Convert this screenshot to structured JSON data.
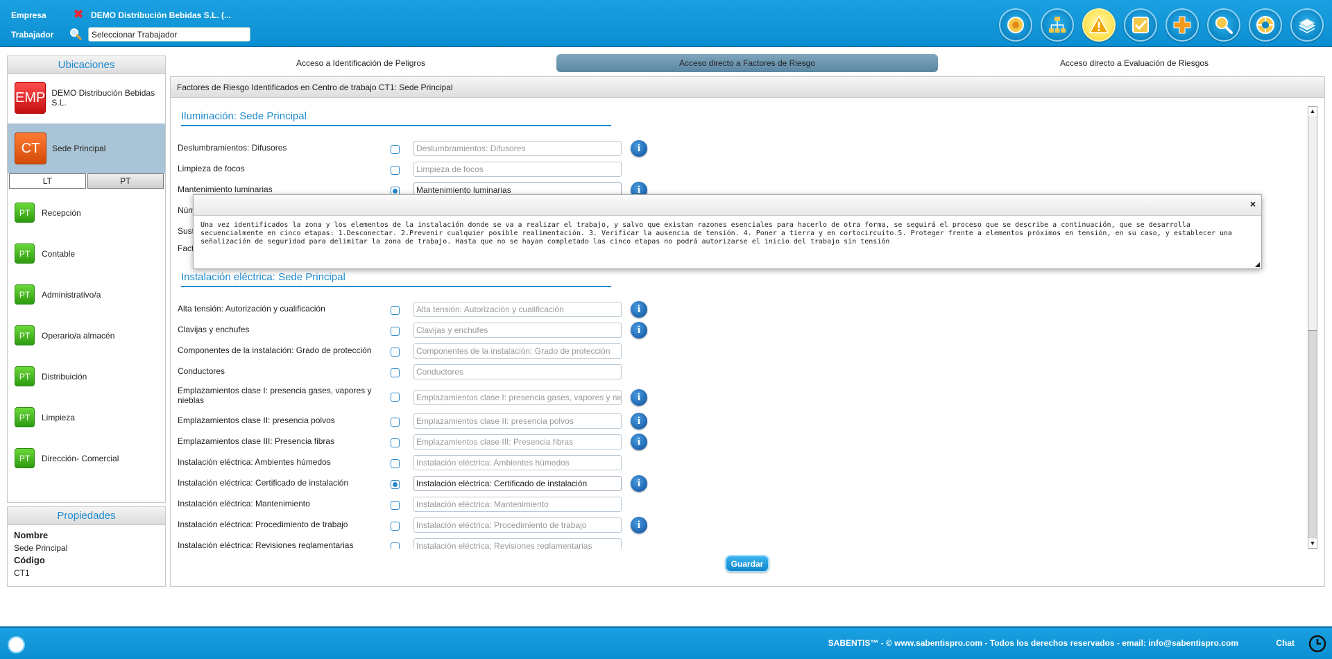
{
  "header": {
    "empresa_label": "Empresa",
    "empresa_value": "DEMO Distribución Bebidas S.L. (...",
    "trabajador_label": "Trabajador",
    "trabajador_value": "Seleccionar Trabajador",
    "icons": [
      "dashboard-icon",
      "org-chart-icon",
      "warning-icon",
      "checklist-icon",
      "add-icon",
      "search-icon",
      "help-icon",
      "documents-icon"
    ],
    "active_icon": "warning-icon"
  },
  "sidebar": {
    "title": "Ubicaciones",
    "empresa": {
      "badge": "EMP",
      "name": "DEMO Distribución Bebidas S.L."
    },
    "centro": {
      "badge": "CT",
      "name": "Sede Principal"
    },
    "tabs": [
      "LT",
      "PT"
    ],
    "active_tab": "PT",
    "puestos": [
      {
        "badge": "PT",
        "name": "Recepción"
      },
      {
        "badge": "PT",
        "name": "Contable"
      },
      {
        "badge": "PT",
        "name": "Administrativo/a"
      },
      {
        "badge": "PT",
        "name": "Operario/a almacén"
      },
      {
        "badge": "PT",
        "name": "Distribuición"
      },
      {
        "badge": "PT",
        "name": "Limpieza"
      },
      {
        "badge": "PT",
        "name": "Dirección- Comercial"
      }
    ]
  },
  "properties": {
    "title": "Propiedades",
    "name_key": "Nombre",
    "name_value": "Sede Principal",
    "code_key": "Código",
    "code_value": "CT1"
  },
  "nav_tabs": [
    "Acceso a Identificación de Peligros",
    "Acceso directo a Factores de Riesgo",
    "Acceso directo a Evaluación de Riesgos"
  ],
  "active_nav_tab": 1,
  "main": {
    "heading": "Factores de Riesgo Identificados en  Centro de trabajo CT1: Sede Principal",
    "sections": [
      {
        "title": "Iluminación: Sede Principal",
        "rows": [
          {
            "label": "Deslumbramientos: Difusores",
            "checked": false,
            "value": "Deslumbramientos: Difusores",
            "info": true
          },
          {
            "label": "Limpieza de focos",
            "checked": false,
            "value": "Limpieza de focos",
            "info": false
          },
          {
            "label": "Mantenimiento luminarias",
            "checked": true,
            "value": "Mantenimiento luminarias",
            "info": true
          },
          {
            "label": "Núm",
            "checked": false,
            "value": "",
            "info": false
          },
          {
            "label": "Sust",
            "checked": false,
            "value": "",
            "info": false
          },
          {
            "label": "Fact",
            "checked": false,
            "value": "",
            "info": false
          }
        ]
      },
      {
        "title": "Instalación eléctrica: Sede Principal",
        "rows": [
          {
            "label": "Alta tensión: Autorización y cualificación",
            "checked": false,
            "value": "Alta tensión: Autorización y cualificación",
            "info": true
          },
          {
            "label": "Clavijas y enchufes",
            "checked": false,
            "value": "Clavijas y enchufes",
            "info": true
          },
          {
            "label": "Componentes de la instalación: Grado de protección",
            "checked": false,
            "value": "Componentes de la instalación: Grado de protección",
            "info": false
          },
          {
            "label": "Conductores",
            "checked": false,
            "value": "Conductores",
            "info": false
          },
          {
            "label": "Emplazamientos clase I: presencia gases, vapores y nieblas",
            "checked": false,
            "value": "Emplazamientos clase I: presencia gases, vapores y nie",
            "info": true
          },
          {
            "label": "Emplazamientos clase II: presencia polvos",
            "checked": false,
            "value": "Emplazamientos clase II: presencia polvos",
            "info": true
          },
          {
            "label": "Emplazamientos clase III: Presencia fibras",
            "checked": false,
            "value": "Emplazamientos clase III: Presencia fibras",
            "info": true
          },
          {
            "label": "Instalación eléctrica: Ambientes húmedos",
            "checked": false,
            "value": "Instalación eléctrica: Ambientes húmedos",
            "info": false
          },
          {
            "label": "Instalación eléctrica: Certificado de instalación",
            "checked": true,
            "value": "Instalación eléctrica: Certificado de instalación",
            "info": true
          },
          {
            "label": "Instalación eléctrica: Mantenimiento",
            "checked": false,
            "value": "Instalación eléctrica: Mantenimiento",
            "info": false
          },
          {
            "label": "Instalación eléctrica: Procedimiento de trabajo",
            "checked": false,
            "value": "Instalación eléctrica: Procedimiento de trabajo",
            "info": true
          },
          {
            "label": "Instalación eléctrica: Revisiones reglamentarias",
            "checked": false,
            "value": "Instalación eléctrica: Revisiones reglamentarias",
            "info": false
          }
        ]
      }
    ],
    "save_label": "Guardar"
  },
  "popup": {
    "close_label": "×",
    "text": "Una vez identificados la zona y los elementos de la instalación donde se va a realizar el trabajo, y salvo que existan razones esenciales para hacerlo de otra forma, se seguirá el proceso que se describe a continuación, que se desarrolla secuencialmente en cinco etapas: 1.Desconectar. 2.Prevenir cualquier posible realimentación. 3. Verificar la ausencia de tensión. 4. Poner a tierra y en cortocircuito.5. Proteger frente a elementos próximos en tensión, en su caso, y establecer una señalización de seguridad para delimitar la zona de trabajo. Hasta que no se hayan completado las cinco etapas no podrá autorizarse el inicio del trabajo sin tensión"
  },
  "footer": {
    "copyright": "SABENTIS™ -  ©  www.sabentispro.com  - Todos los derechos reservados -  email: info@sabentispro.com",
    "chat_label": "Chat"
  }
}
